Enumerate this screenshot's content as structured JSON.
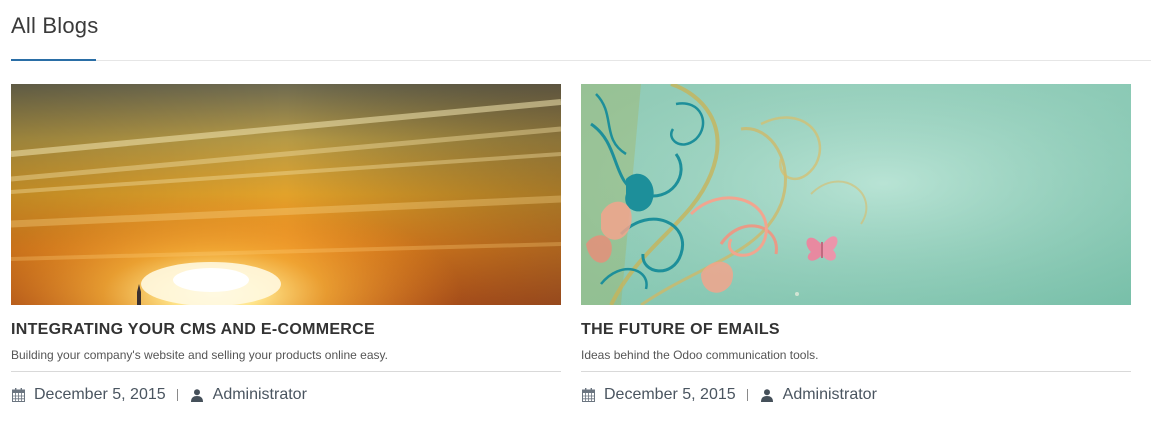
{
  "header": {
    "title": "All Blogs"
  },
  "colors": {
    "accent_underline": "#2a6ea6",
    "text_dark": "#333333",
    "meta_text": "#4a5560"
  },
  "posts": [
    {
      "title": "INTEGRATING YOUR CMS AND E-COMMERCE",
      "subtitle": "Building your company's website and selling your products online easy.",
      "date": "December 5, 2015",
      "author": "Administrator",
      "cover_icon": "sunset-image"
    },
    {
      "title": "THE FUTURE OF EMAILS",
      "subtitle": "Ideas behind the Odoo communication tools.",
      "date": "December 5, 2015",
      "author": "Administrator",
      "cover_icon": "floral-butterfly-image"
    }
  ]
}
